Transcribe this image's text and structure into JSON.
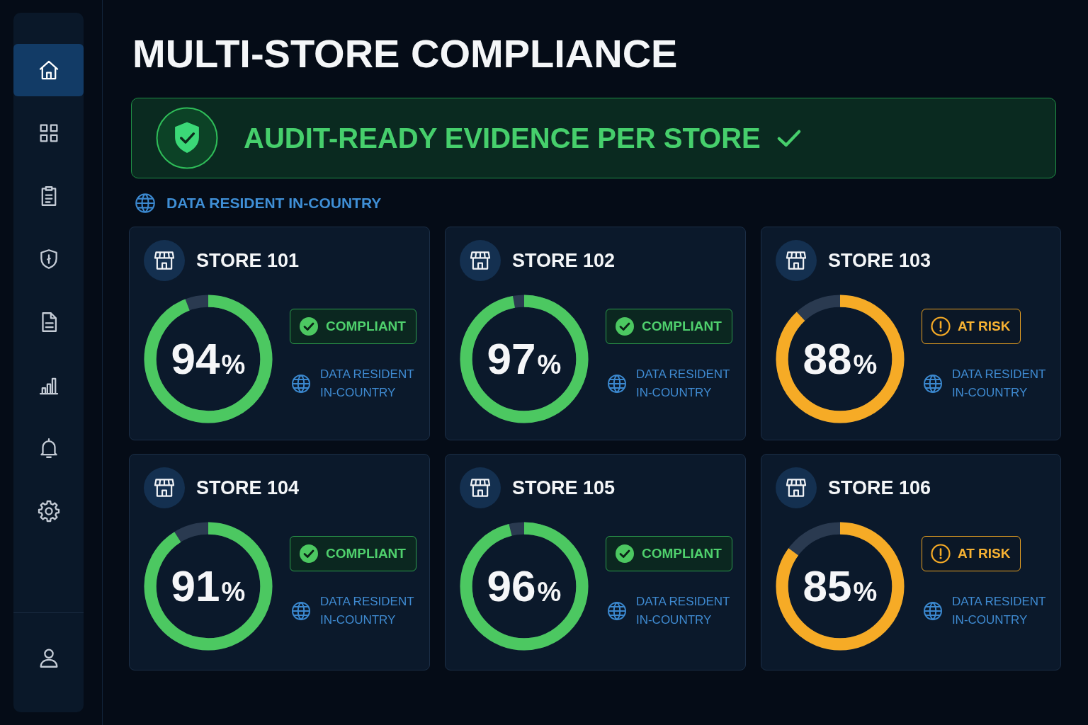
{
  "sidebar": {
    "items": [
      {
        "selected": true
      },
      {
        "selected": false
      },
      {
        "selected": false
      },
      {
        "selected": false
      },
      {
        "selected": false
      },
      {
        "selected": false
      },
      {
        "selected": false
      },
      {
        "selected": false
      }
    ]
  },
  "title": "MULTI-STORE COMPLIANCE",
  "banner": {
    "text": "AUDIT-READY EVIDENCE PER STORE"
  },
  "residency": {
    "label": "DATA RESIDENT IN-COUNTRY"
  },
  "stores": [
    {
      "name": "STORE 101",
      "value": "94",
      "unit": "%",
      "level": 0.94,
      "status": {
        "kind": "compliant",
        "label": "COMPLIANT"
      },
      "residency": "DATA RESIDENT IN-COUNTRY"
    },
    {
      "name": "STORE 102",
      "value": "97",
      "unit": "%",
      "level": 0.97,
      "status": {
        "kind": "compliant",
        "label": "COMPLIANT"
      },
      "residency": "DATA RESIDENT IN-COUNTRY"
    },
    {
      "name": "STORE 103",
      "value": "88",
      "unit": "%",
      "level": 0.88,
      "status": {
        "kind": "at_risk",
        "label": "AT RISK"
      },
      "residency": "DATA RESIDENT IN-COUNTRY"
    },
    {
      "name": "STORE 104",
      "value": "91",
      "unit": "%",
      "level": 0.91,
      "status": {
        "kind": "compliant",
        "label": "COMPLIANT"
      },
      "residency": "DATA RESIDENT IN-COUNTRY"
    },
    {
      "name": "STORE 105",
      "value": "96",
      "unit": "%",
      "level": 0.96,
      "status": {
        "kind": "compliant",
        "label": "COMPLIANT"
      },
      "residency": "DATA RESIDENT IN-COUNTRY"
    },
    {
      "name": "STORE 106",
      "value": "85",
      "unit": "%",
      "level": 0.85,
      "status": {
        "kind": "at_risk",
        "label": "AT RISK"
      },
      "residency": "DATA RESIDENT IN-COUNTRY"
    }
  ]
}
